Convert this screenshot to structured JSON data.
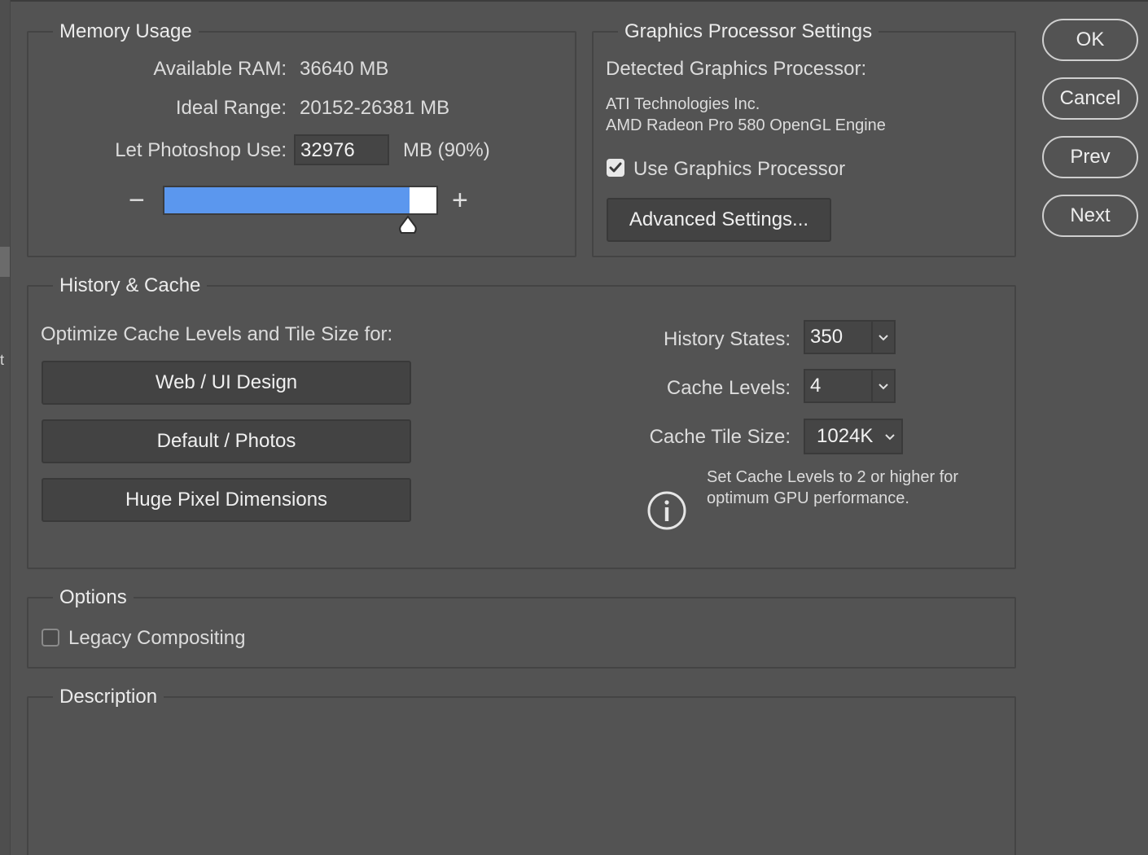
{
  "memory": {
    "legend": "Memory Usage",
    "available_label": "Available RAM:",
    "available_value": "36640 MB",
    "ideal_label": "Ideal Range:",
    "ideal_value": "20152-26381 MB",
    "use_label": "Let Photoshop Use:",
    "use_value": "32976",
    "use_unit": "MB (90%)",
    "minus": "−",
    "plus": "+",
    "slider_fraction": 0.9
  },
  "gpu": {
    "legend": "Graphics Processor Settings",
    "detected_label": "Detected Graphics Processor:",
    "vendor": "ATI Technologies Inc.",
    "model": "AMD Radeon Pro 580 OpenGL Engine",
    "use_gpu_label": "Use Graphics Processor",
    "use_gpu_checked": true,
    "advanced_button": "Advanced Settings..."
  },
  "history": {
    "legend": "History & Cache",
    "optimize_label": "Optimize Cache Levels and Tile Size for:",
    "preset_buttons": [
      "Web / UI Design",
      "Default / Photos",
      "Huge Pixel Dimensions"
    ],
    "history_states_label": "History States:",
    "history_states_value": "350",
    "cache_levels_label": "Cache Levels:",
    "cache_levels_value": "4",
    "tile_size_label": "Cache Tile Size:",
    "tile_size_value": "1024K",
    "info_line1": "Set Cache Levels to 2 or higher for",
    "info_line2": "optimum GPU performance."
  },
  "options": {
    "legend": "Options",
    "legacy_label": "Legacy Compositing",
    "legacy_checked": false
  },
  "description": {
    "legend": "Description"
  },
  "actions": {
    "ok": "OK",
    "cancel": "Cancel",
    "prev": "Prev",
    "next": "Next"
  },
  "left_edge_glyph": "t",
  "colors": {
    "background": "#535353",
    "slider_fill": "#5b97ee",
    "border": "#444444"
  }
}
